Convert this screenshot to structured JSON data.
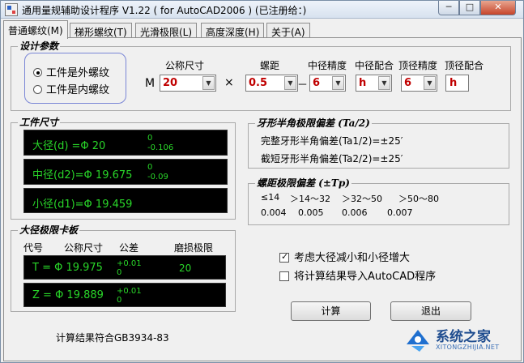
{
  "window": {
    "title": "通用量规辅助设计程序 V1.22 ( for AutoCAD2006 )  (已注册给：)",
    "min_glyph": "─",
    "max_glyph": "□",
    "close_glyph": "✕"
  },
  "tabs": [
    "普通螺纹(M)",
    "梯形螺纹(T)",
    "光滑极限(L)",
    "高度深度(H)",
    "关于(A)"
  ],
  "design": {
    "legend": "设计参数",
    "thread_external": "工件是外螺纹",
    "thread_internal": "工件是内螺纹",
    "prefix_m": "M",
    "times": "×",
    "dash": "－",
    "col_nominal": "公称尺寸",
    "col_pitch": "螺距",
    "col_pd_grade": "中径精度",
    "col_pd_fit": "中径配合",
    "col_top_grade": "顶径精度",
    "col_top_fit": "顶径配合",
    "nominal": "20",
    "pitch": "0.5",
    "pd_grade": "6",
    "pd_fit": "h",
    "top_grade": "6",
    "top_fit": "h"
  },
  "workpiece": {
    "legend": "工件尺寸",
    "major_label": "大径(d) =Φ 20",
    "major_tol_upper": "0",
    "major_tol_lower": "-0.106",
    "pitch_label": "中径(d2)=Φ 19.675",
    "pitch_tol_upper": "0",
    "pitch_tol_lower": "-0.09",
    "minor_label": "小径(d1)=Φ 19.459"
  },
  "flank": {
    "legend": "牙形半角极限偏差 (Ta/2)",
    "full": "完整牙形半角偏差(Ta1/2)=±25′",
    "short": "截短牙形半角偏差(Ta2/2)=±25′"
  },
  "pitch_dev": {
    "legend": "螺距极限偏差 (±Tp)",
    "ranges": [
      "≤14",
      "＞14～32",
      "＞32～50",
      "＞50～80"
    ],
    "values": [
      "0.004",
      "0.005",
      "0.006",
      "0.007"
    ]
  },
  "gauge": {
    "legend": "大径极限卡板",
    "col_code": "代号",
    "col_nominal": "公称尺寸",
    "col_tol": "公差",
    "col_wear": "磨损极限",
    "t_label": "T = Φ 19.975",
    "t_tol_upper": "+0.01",
    "t_tol_lower": "0",
    "t_wear": "20",
    "z_label": "Z = Φ 19.889",
    "z_tol_upper": "+0.01",
    "z_tol_lower": "0"
  },
  "options": {
    "consider": "考虑大径减小和小径增大",
    "export": "将计算结果导入AutoCAD程序"
  },
  "buttons": {
    "calc": "计算",
    "exit": "退出"
  },
  "status": "计算结果符合GB3934-83",
  "watermark": {
    "brand": "系统之家",
    "url": "XITONGZHIJIA.NET"
  },
  "colors": {
    "lcd_bg": "#000000",
    "lcd_text": "#29d629",
    "value_red": "#c00000",
    "brand_blue": "#1f6fcf"
  }
}
